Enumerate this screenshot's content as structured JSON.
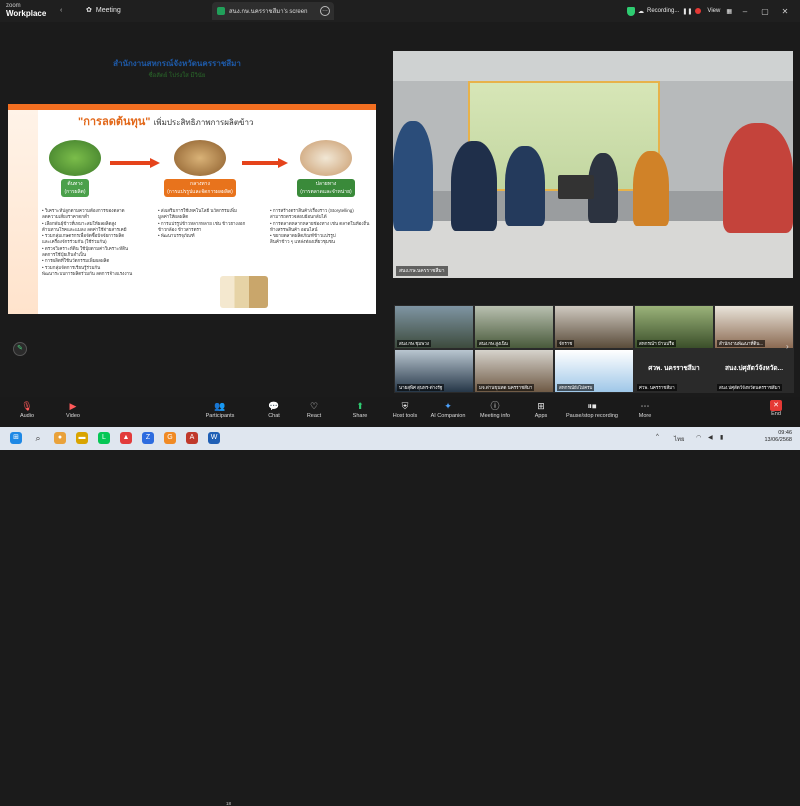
{
  "app": {
    "brand_top": "zoom",
    "brand_bottom": "Workplace"
  },
  "titlebar": {
    "meeting_label": "Meeting",
    "share_tab_label": "สนง.กษ.นครราชสีมา's screen",
    "recording_label": "Recording...",
    "view_label": "View"
  },
  "slide": {
    "title_main": "\"การลดต้นทุน\"",
    "title_rest": "เพิ่มประสิทธิภาพการผลิตข้าว",
    "stage1": "ต้นทาง\n(การผลิต)",
    "stage2": "กลางทาง\n(การแปรรูปและจัดการผลผลิต)",
    "stage3": "ปลายทาง\n(การตลาดและจำหน่าย)",
    "bullets1": [
      "• วิเคราะห์ปลูกตามความต้องการของตลาด",
      "  ลดความเสี่ยงราคาตกต่ำ",
      "• เลือกพันธุ์ข้าวที่เหมาะสมให้ผลผลิตสูง",
      "  ต้านทานโรคและแมลง ลดค่าใช้จ่ายสารเคมี",
      "• รวมกลุ่มเกษตรกรเพื่อจัดซื้อปัจจัยการผลิต",
      "  และเครื่องจักรร่วมกัน (ใช้ร่วมกัน)",
      "• ตรวจวิเคราะห์ดิน ใช้ปุ๋ยตามค่าวิเคราะห์ดิน",
      "  ลดการใช้ปุ๋ยเกินจำเป็น",
      "• การผลิตที่ใช้นวัตกรรมเพิ่มผลผลิต",
      "• รวมกลุ่มจัดการเรียนรู้ร่วมกัน",
      "  พัฒนาระบบการผลิตร่วมกัน ลดการจ้างแรงงาน"
    ],
    "bullets2": [
      "• ส่งเสริมการใช้เทคโนโลยี นวัตกรรมเพิ่ม",
      "  มูลค่าให้ผลผลิต",
      "• การแปรรูปข้าวหลากหลาย เช่น ข้าวฮางงอก",
      "  ข้าวกล้อง ข้าวสารตรา",
      "• พัฒนาบรรจุภัณฑ์"
    ],
    "bullets3": [
      "• การสร้างตราสินค้า/เรื่องราว (Storytelling)",
      "  สามารถตรวจสอบย้อนกลับได้",
      "• การตลาดหลากหลายช่องทาง เช่น ตลาดในท้องถิ่น",
      "  ห้างสรรพสินค้า ออนไลน์",
      "• ขยายตลาดผลิตภัณฑ์ข้าวแปรรูป",
      "  สินค้าข้าว ๆ แหล่งท่องเที่ยวชุมชน"
    ]
  },
  "main_video": {
    "banner_title": "สำนักงานสหกรณ์จังหวัดนครราชสีมา",
    "banner_sub": "ซื่อสัตย์ โปร่งใส มีวินัย",
    "participant_label": "สนง.กษ.นครราชสีมา"
  },
  "tiles": [
    {
      "name": "สนง.กษ.ชุมพวง"
    },
    {
      "name": "สนง.กษ.สูงเนิน"
    },
    {
      "name": "จักราช"
    },
    {
      "name": "สหกรณ์ฯ บ้านปรือ"
    },
    {
      "name": "สำนักงานพัฒนาที่ดิน..."
    },
    {
      "name": "นายสุพิศ สุนทร-ต่างรัฐ"
    },
    {
      "name": "มจ.ด่านขุนทด นครราชสีมา"
    },
    {
      "name": "สหกรณ์ยังไม่ครบ"
    },
    {
      "name": "ศวพ. นครราชสีมา",
      "big": "ศวพ. นครราชสีมา"
    },
    {
      "name": "สนง.ปศุสัตว์จังหวัดนครราชสีมา",
      "big": "สนง.ปศุสัตว์จังหวัด..."
    }
  ],
  "toolbar": {
    "audio": "Audio",
    "video": "Video",
    "participants": "Participants",
    "participants_count": "18",
    "chat": "Chat",
    "react": "React",
    "share": "Share",
    "host_tools": "Host tools",
    "ai_companion": "AI Companion",
    "meeting_info": "Meeting info",
    "apps": "Apps",
    "pause_stop_recording": "Pause/stop recording",
    "more": "More",
    "end": "End"
  },
  "taskbar": {
    "language": "ไทย",
    "time": "09:46",
    "date": "13/06/2568"
  },
  "icons": {
    "accent_green": "#2ecc71",
    "record_red": "#e53935",
    "slide_orange": "#f36f21"
  }
}
